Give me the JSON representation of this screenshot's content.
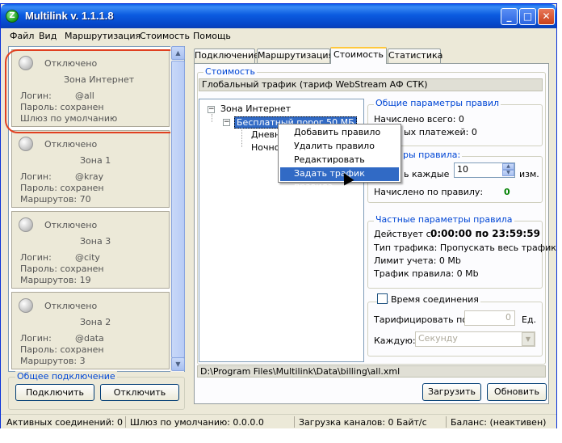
{
  "window": {
    "title": "Multilink v. 1.1.1.8",
    "icon_letter": "Z"
  },
  "menu": [
    "Файл",
    "Вид",
    "Маршрутизация",
    "Стоимость",
    "Помощь"
  ],
  "connections": [
    {
      "status": "Отключено",
      "zone": "Зона Интернет",
      "login_label": "Логин:",
      "login": "@all",
      "password": "Пароль: сохранен",
      "extra": "Шлюз по умолчанию"
    },
    {
      "status": "Отключено",
      "zone": "Зона 1",
      "login_label": "Логин:",
      "login": "@kray",
      "password": "Пароль: сохранен",
      "extra": "Маршрутов: 70"
    },
    {
      "status": "Отключено",
      "zone": "Зона 3",
      "login_label": "Логин:",
      "login": "@city",
      "password": "Пароль: сохранен",
      "extra": "Маршрутов: 19"
    },
    {
      "status": "Отключено",
      "zone": "Зона 2",
      "login_label": "Логин:",
      "login": "@data",
      "password": "Пароль: сохранен",
      "extra": "Маршрутов: 3"
    }
  ],
  "common": {
    "title": "Общее подключение",
    "connect": "Подключить",
    "disconnect": "Отключить"
  },
  "tabs": [
    "Подключение",
    "Маршрутизация",
    "Стоимость",
    "Статистика"
  ],
  "cost": {
    "group_title": "Стоимость",
    "global": "Глобальный трафик (тариф WebStream АФ СТК)",
    "tree": {
      "root": "Зона Интернет",
      "child": "Бесплатный порог 50 МБ",
      "leaf1": "Дневн",
      "leaf2": "Ночно"
    },
    "context_menu": [
      "Добавить правило",
      "Удалить правило",
      "Редактировать правило",
      "Задать трафик правила"
    ],
    "general": {
      "title": "Общие параметры правил",
      "charged_total": "Начислено всего: 0",
      "payments": "ых платежей: 0"
    },
    "rule": {
      "title": "ры правила:",
      "each_label": "ь каждые",
      "each_value": "10",
      "unit": "изм.",
      "charged_label": "Начислено по правилу:",
      "charged_value": "0"
    },
    "private": {
      "title": "Частные параметры правила",
      "active_label": "Действует с:",
      "active_value": "0:00:00 по 23:59:59",
      "traffic_type": "Тип трафика: Пропускать весь трафик",
      "limit": "Лимит учета: 0 Mb",
      "rule_traffic": "Трафик правила: 0 Mb"
    },
    "time": {
      "title": "Время соединения",
      "tariff_label": "Тарифицировать по:",
      "tariff_value": "0",
      "tariff_unit": "Ед.",
      "each_label": "Каждую:",
      "each_value": "Секунду"
    },
    "path": "D:\\Program Files\\Multilink\\Data\\billing\\all.xml",
    "load": "Загрузить",
    "refresh": "Обновить"
  },
  "status": {
    "active": "Активных соединений: 0",
    "gateway": "Шлюз по умолчанию: 0.0.0.0",
    "load": "Загрузка каналов: 0 Байт/с",
    "balance": "Баланс: (неактивен)"
  },
  "colors": {
    "accent": "#316ac5",
    "selection_ring": "#e04020",
    "positive": "#008000"
  }
}
